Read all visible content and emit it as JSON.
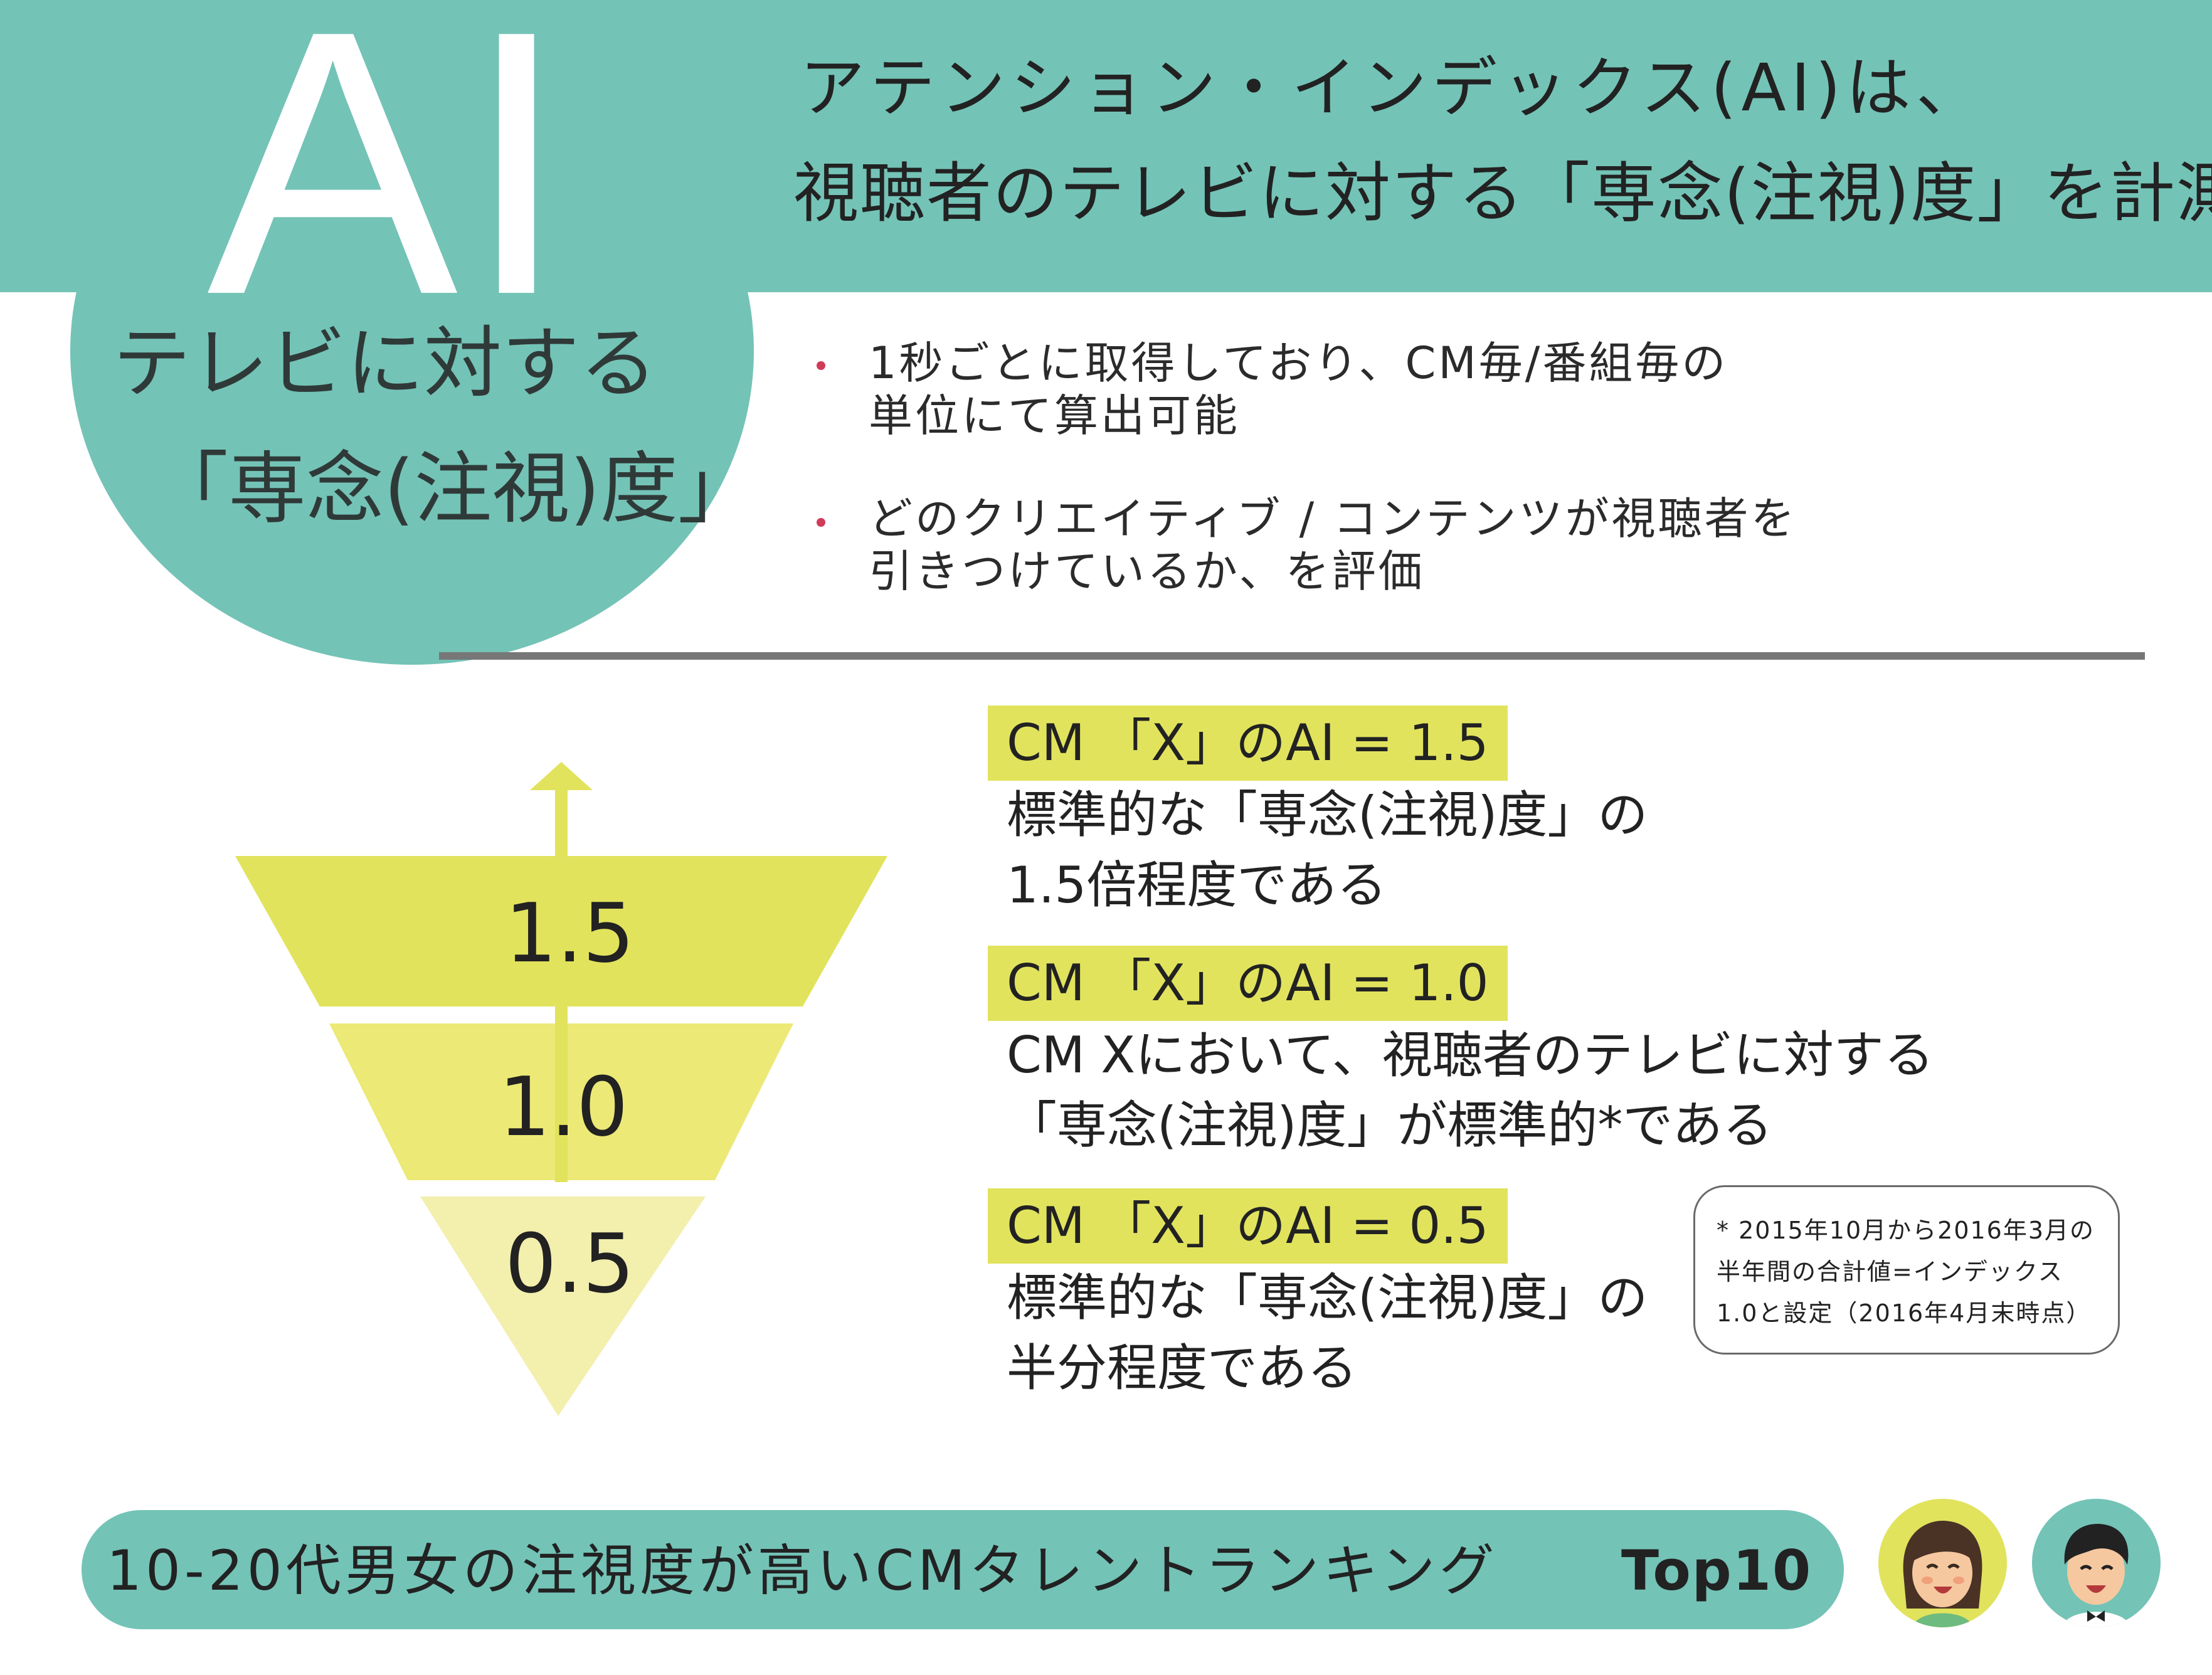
{
  "colors": {
    "teal": "#74c3b7",
    "tier_high": "#e1e35d",
    "tier_mid": "#ece976",
    "tier_low": "#f3efad",
    "highlight": "#e1e35d",
    "bullet": "#d23a5a",
    "divider": "#777777",
    "arrow": "#e1e35d"
  },
  "header": {
    "logo": "AI",
    "circle_line1": "テレビに対する",
    "circle_line2": "「専念(注視)度」",
    "title_line1": "アテンション・インデックス(AI)は、",
    "title_line2": "視聴者のテレビに対する「専念(注視)度」を計測"
  },
  "bullets": [
    {
      "line1": "1秒ごとに取得しており、CM毎/番組毎の",
      "line2": "単位にて算出可能"
    },
    {
      "line1": "どのクリエイティブ / コンテンツが視聴者を",
      "line2": "引きつけているか、を評価"
    }
  ],
  "scale": {
    "tiers": [
      {
        "value": "1.5"
      },
      {
        "value": "1.0"
      },
      {
        "value": "0.5"
      }
    ]
  },
  "explanations": [
    {
      "heading": "CM 「X」のAI = 1.5",
      "body1": "標準的な「専念(注視)度」の",
      "body2": "1.5倍程度である"
    },
    {
      "heading": "CM 「X」のAI = 1.0",
      "body1": "CM Xにおいて、視聴者のテレビに対する",
      "body2": "「専念(注視)度」が標準的*である"
    },
    {
      "heading": "CM 「X」のAI = 0.5",
      "body1": "標準的な「専念(注視)度」の",
      "body2": "半分程度である"
    }
  ],
  "footnote": {
    "line1": "* 2015年10月から2016年3月の",
    "line2": "半年間の合計値=インデックス",
    "line3": "1.0と設定（2016年4月末時点）"
  },
  "footer": {
    "text": "10-20代男女の注視度が高いCMタレントランキング",
    "top10": "Top10"
  }
}
